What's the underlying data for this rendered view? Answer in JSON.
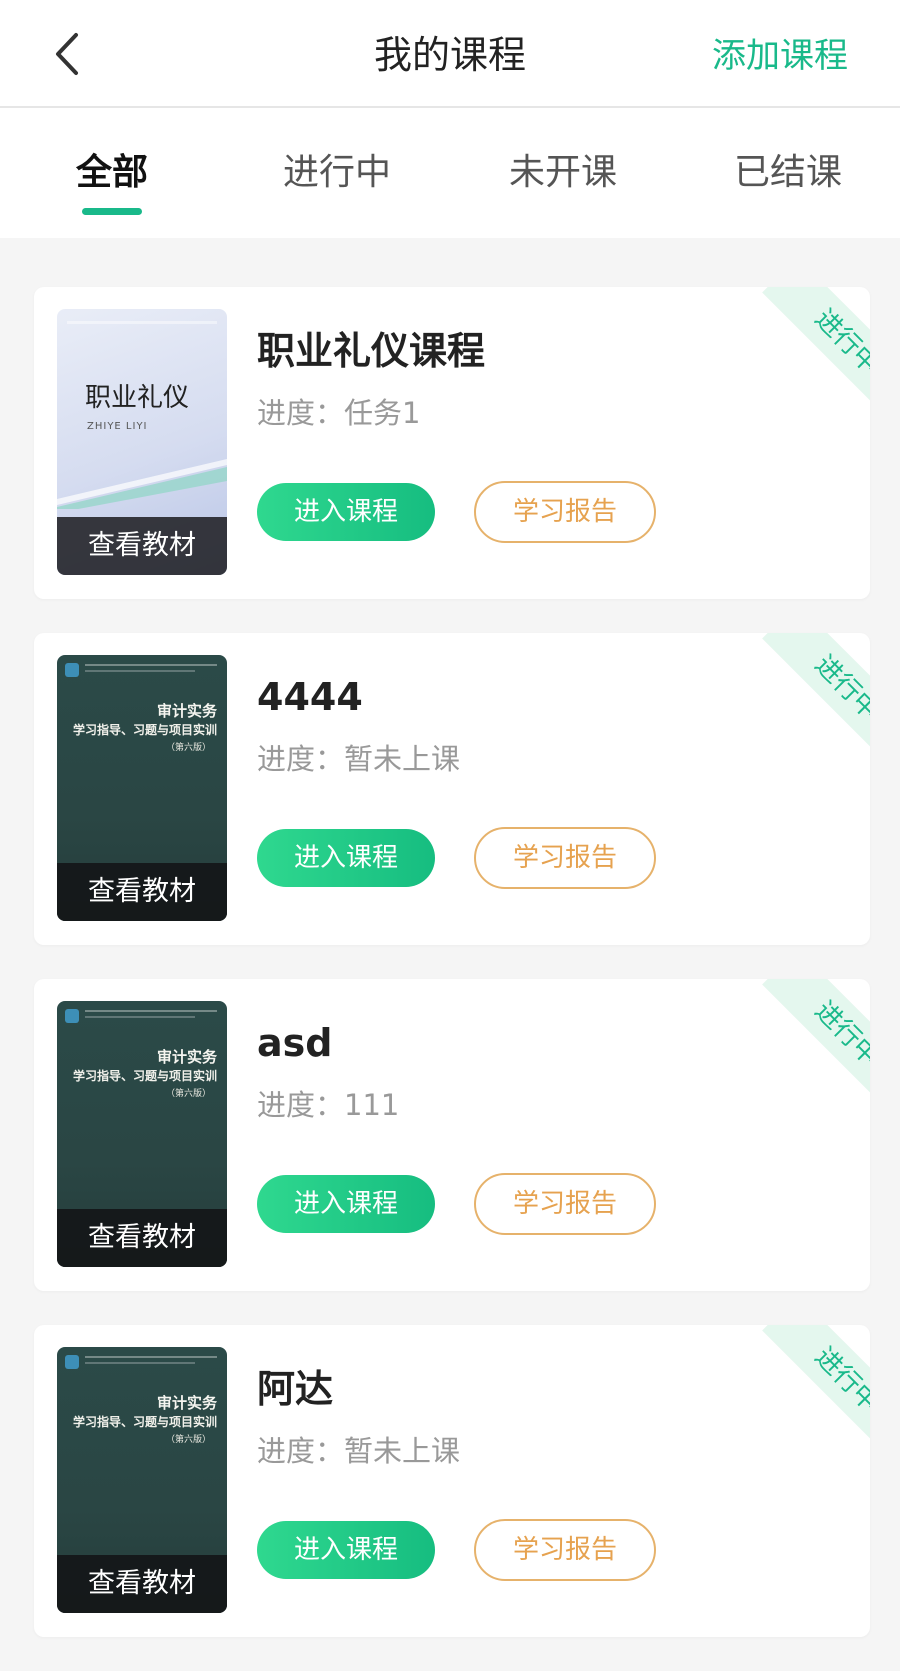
{
  "header": {
    "title": "我的课程",
    "add_label": "添加课程"
  },
  "tabs": [
    {
      "label": "全部",
      "active": true
    },
    {
      "label": "进行中",
      "active": false
    },
    {
      "label": "未开课",
      "active": false
    },
    {
      "label": "已结课",
      "active": false
    }
  ],
  "courses": [
    {
      "title": "职业礼仪课程",
      "progress": "进度：任务1",
      "status": "进行中",
      "cover_style": "light",
      "cover_title": "职业礼仪",
      "cover_subtitle": "ZHIYE LIYI",
      "view_label": "查看教材",
      "enter_label": "进入课程",
      "report_label": "学习报告"
    },
    {
      "title": "4444",
      "progress": "进度：暂未上课",
      "status": "进行中",
      "cover_style": "dark",
      "cover_title": "审计实务",
      "cover_subtitle": "学习指导、习题与项目实训",
      "cover_edition": "（第六版）",
      "view_label": "查看教材",
      "enter_label": "进入课程",
      "report_label": "学习报告"
    },
    {
      "title": "asd",
      "progress": "进度：111",
      "status": "进行中",
      "cover_style": "dark",
      "cover_title": "审计实务",
      "cover_subtitle": "学习指导、习题与项目实训",
      "cover_edition": "（第六版）",
      "view_label": "查看教材",
      "enter_label": "进入课程",
      "report_label": "学习报告"
    },
    {
      "title": "阿达",
      "progress": "进度：暂未上课",
      "status": "进行中",
      "cover_style": "dark",
      "cover_title": "审计实务",
      "cover_subtitle": "学习指导、习题与项目实训",
      "cover_edition": "（第六版）",
      "view_label": "查看教材",
      "enter_label": "进入课程",
      "report_label": "学习报告"
    }
  ],
  "colors": {
    "accent": "#19b98a",
    "report": "#e6a24f",
    "ribbon_bg": "#e4f7ee"
  }
}
